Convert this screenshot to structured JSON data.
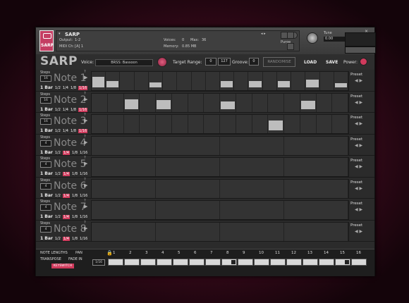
{
  "kontakt": {
    "logo_text": "SARP",
    "instrument_name": "SARP",
    "output_label": "Output:",
    "output_value": "1-2",
    "midi_label": "MIDI Ch:",
    "midi_value": "[A] 1",
    "voices_label": "Voices:",
    "voices_value": "0",
    "max_label": "Max:",
    "max_value": "36",
    "memory_label": "Memory:",
    "memory_value": "0.85 MB",
    "purge_label": "Purge",
    "tune_label": "Tune",
    "tune_value": "0.00",
    "close_glyph": "×"
  },
  "header": {
    "logo": "SARP",
    "voice_label": "Voice:",
    "voice_value": "BRSS: Bassoon",
    "target_range_label": "Target Range:",
    "range_low": "0",
    "range_high": "127",
    "groove_label": "Groove:",
    "groove_value": "0",
    "randomise_label": "RANDOMISE",
    "load_label": "LOAD",
    "save_label": "SAVE",
    "power_label": "Power:"
  },
  "row_labels": {
    "steps": "Steps",
    "preset": "Preset",
    "arrows": "◀ ▶",
    "play": "▶",
    "help": "?"
  },
  "rows": [
    {
      "name": "Note 1",
      "steps": "16",
      "lengths": [
        "1 Bar",
        "1/2",
        "1/4",
        "1/8",
        "1/16"
      ],
      "selected": 4,
      "velocities": [
        0.85,
        0.5,
        0,
        0,
        0.4,
        0,
        0,
        0,
        0,
        0.5,
        0,
        0.5,
        0,
        0.5,
        0,
        0.6,
        0,
        0.35
      ]
    },
    {
      "name": "Note 2",
      "steps": "16",
      "lengths": [
        "1 Bar",
        "1/2",
        "1/4",
        "1/8",
        "1/16"
      ],
      "selected": 4,
      "velocities": [
        0,
        0,
        0.75,
        0,
        0.7,
        0,
        0,
        0,
        0.6,
        0,
        0,
        0,
        0,
        0.65,
        0,
        0
      ]
    },
    {
      "name": "Note 3",
      "steps": "16",
      "lengths": [
        "1 Bar",
        "1/2",
        "1/4",
        "1/8",
        "1/16"
      ],
      "selected": 4,
      "velocities": [
        0,
        0,
        0,
        0,
        0,
        0,
        0,
        0,
        0,
        0,
        0,
        0.75,
        0,
        0,
        0,
        0
      ]
    },
    {
      "name": "Note 4",
      "steps": "4",
      "lengths": [
        "1 Bar",
        "1/2",
        "1/4",
        "1/8",
        "1/16"
      ],
      "selected": 2,
      "velocities": [
        0,
        0,
        0,
        0
      ]
    },
    {
      "name": "Note 5",
      "steps": "4",
      "lengths": [
        "1 Bar",
        "1/2",
        "1/4",
        "1/8",
        "1/16"
      ],
      "selected": 2,
      "velocities": [
        0,
        0,
        0,
        0
      ]
    },
    {
      "name": "Note 6",
      "steps": "4",
      "lengths": [
        "1 Bar",
        "1/2",
        "1/4",
        "1/8",
        "1/16"
      ],
      "selected": 2,
      "velocities": [
        0,
        0,
        0,
        0
      ]
    },
    {
      "name": "Note 7",
      "steps": "4",
      "lengths": [
        "1 Bar",
        "1/2",
        "1/4",
        "1/8",
        "1/16"
      ],
      "selected": 2,
      "velocities": [
        0,
        0,
        0,
        0
      ]
    },
    {
      "name": "Note 8",
      "steps": "4",
      "lengths": [
        "1 Bar",
        "1/2",
        "1/4",
        "1/8",
        "1/16"
      ],
      "selected": 2,
      "velocities": [
        0,
        0,
        0,
        0
      ]
    }
  ],
  "bottom": {
    "note_lengths": "NOTE LENGTHS",
    "pan": "PAN",
    "transpose": "TRANSPOSE",
    "fade_in": "FADE IN",
    "keyswitch": "KEYSWITCH",
    "value_box": "1/16",
    "lock_icon": "🔒",
    "columns": [
      "1",
      "2",
      "3",
      "4",
      "5",
      "6",
      "7",
      "8",
      "9",
      "10",
      "11",
      "12",
      "13",
      "14",
      "15",
      "16"
    ],
    "dark_columns": [
      8,
      15
    ]
  }
}
